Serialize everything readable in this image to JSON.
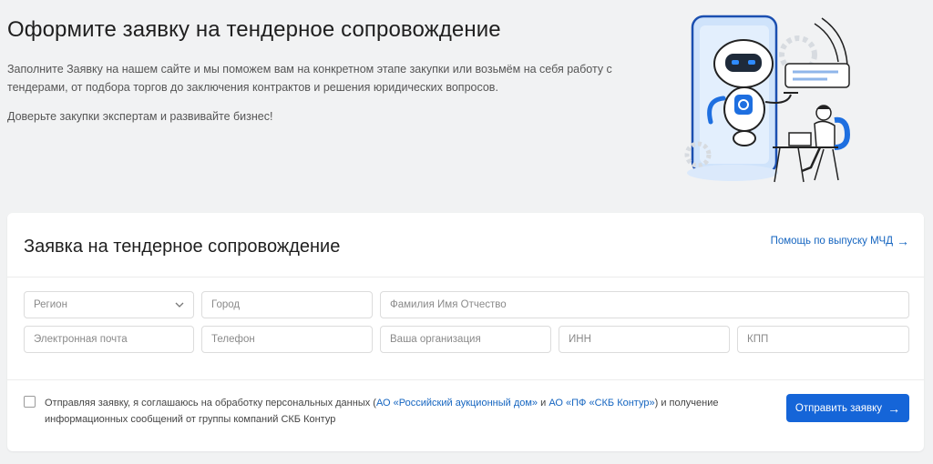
{
  "hero": {
    "title": "Оформите заявку на тендерное сопровождение",
    "description": "Заполните Заявку на нашем сайте и мы поможем вам на конкретном этапе закупки или возьмём на себя работу с тендерами, от подбора торгов до заключения контрактов и решения юридических вопросов.",
    "note": "Доверьте закупки экспертам и развивайте бизнес!"
  },
  "form": {
    "title": "Заявка на тендерное сопровождение",
    "help_link": "Помощь по выпуску МЧД",
    "fields": {
      "region": "Регион",
      "city": "Город",
      "fio": "Фамилия Имя Отчество",
      "email": "Электронная почта",
      "phone": "Телефон",
      "organization": "Ваша организация",
      "inn": "ИНН",
      "kpp": "КПП"
    },
    "consent": {
      "prefix": "Отправляя заявку, я соглашаюсь на обработку персональных данных (",
      "link1": "АО «Российский аукционный дом»",
      "middle": " и ",
      "link2": "АО «ПФ «СКБ Контур»",
      "suffix": ") и получение информационных сообщений от группы компаний СКБ Контур"
    },
    "submit_label": "Отправить заявку"
  },
  "colors": {
    "accent": "#1565d8",
    "link": "#1565c0",
    "page_bg": "#f1f2f3"
  },
  "icons": {
    "help_arrow": "arrow-right-icon",
    "submit_arrow": "arrow-right-icon",
    "region_chevron": "chevron-down-icon"
  }
}
